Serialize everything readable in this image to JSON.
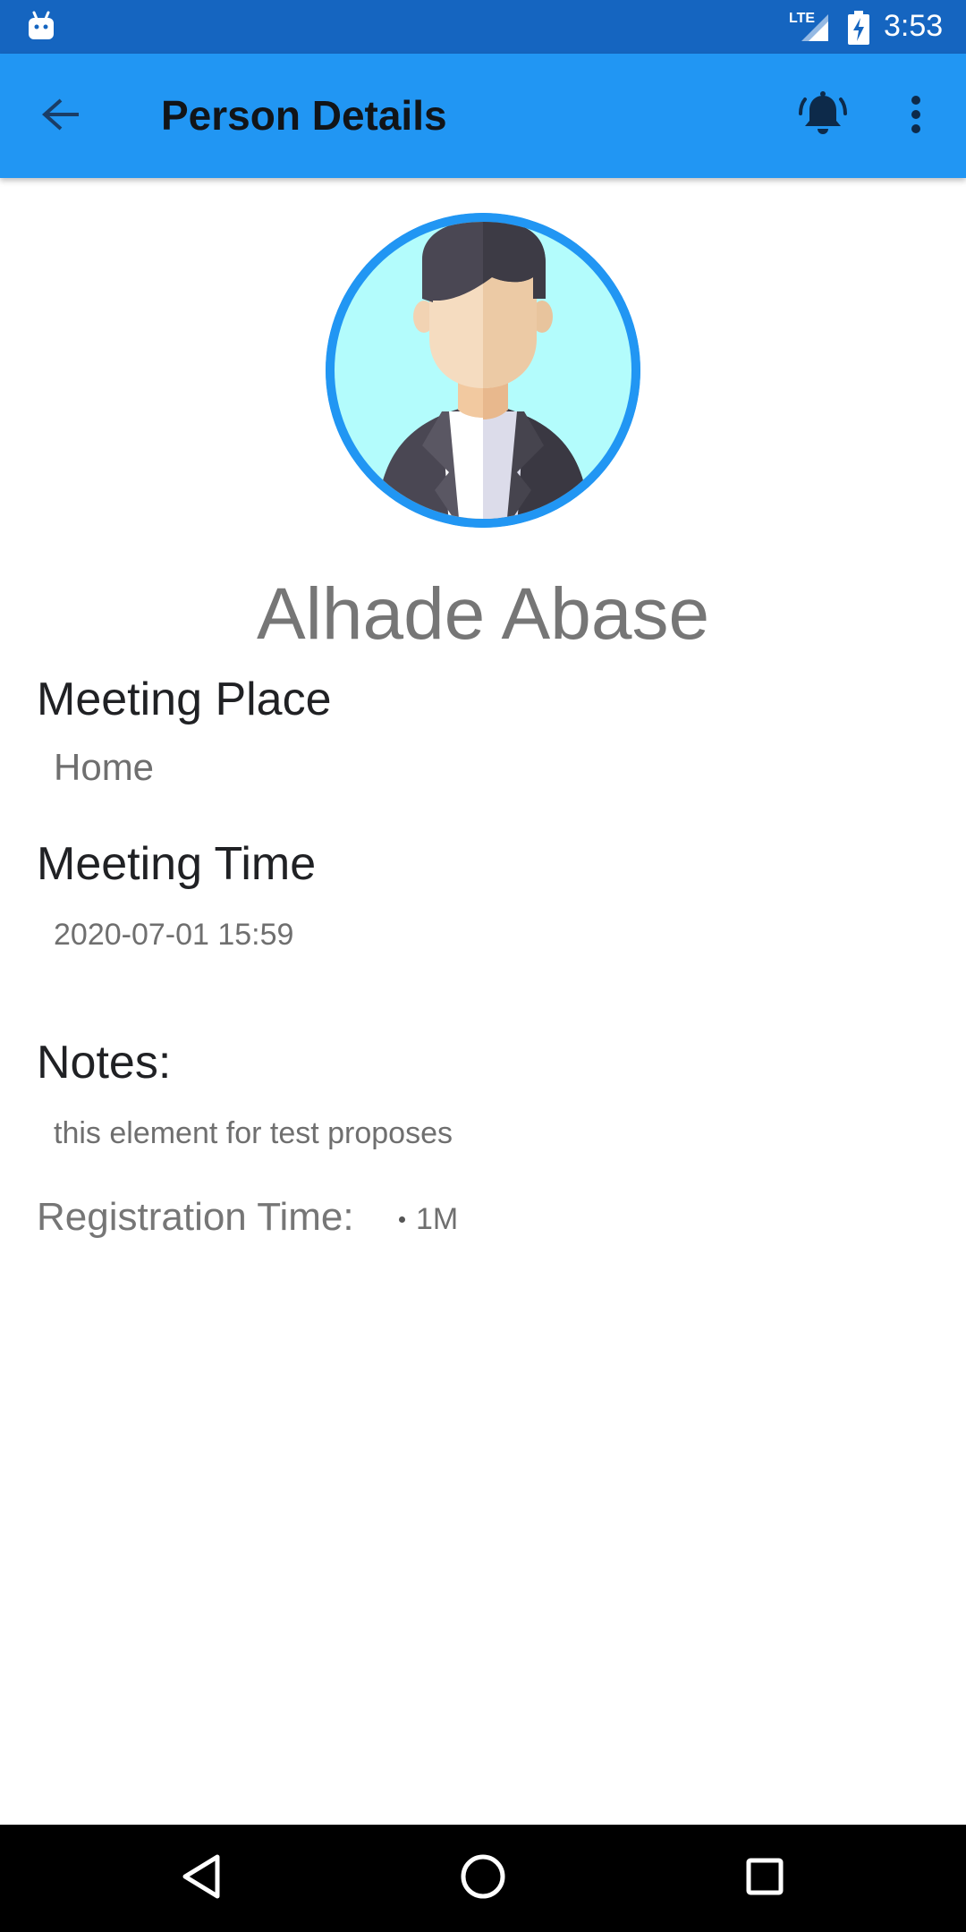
{
  "status_bar": {
    "network": "LTE",
    "time": "3:53"
  },
  "app_bar": {
    "title": "Person Details",
    "back_icon": "arrow-back-icon",
    "bell_icon": "alarm-bell-icon",
    "more_icon": "more-vert-icon"
  },
  "person": {
    "avatar_icon": "person-avatar-icon",
    "name": "Alhade Abase"
  },
  "details": {
    "meeting_place_label": "Meeting Place",
    "meeting_place_value": "Home",
    "meeting_time_label": "Meeting Time",
    "meeting_time_value": "2020-07-01 15:59",
    "notes_label": "Notes:",
    "notes_value": "this element for test proposes",
    "registration_label": "Registration Time:",
    "registration_value": "1M"
  },
  "colors": {
    "status_bar": "#1565c0",
    "app_bar": "#2196f3",
    "avatar_ring": "#2196f3",
    "avatar_bg": "#b3fcfc"
  },
  "nav_bar": {
    "back_icon": "nav-back-icon",
    "home_icon": "nav-home-icon",
    "recent_icon": "nav-recent-icon"
  }
}
